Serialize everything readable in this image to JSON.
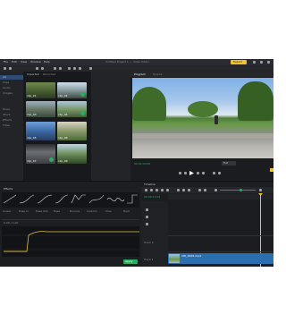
{
  "app": {
    "window_title": "Untitled Project 1 — Video Editor",
    "menu": [
      "File",
      "Edit",
      "View",
      "Window",
      "Help"
    ],
    "badge_label": "Export",
    "colors": {
      "bg": "#1f2024",
      "panel": "#232428",
      "accent_yellow": "#f2c12e",
      "accent_green": "#27ae60",
      "accent_blue": "#2a6fb0"
    }
  },
  "media_panel": {
    "tabs": [
      "Imported",
      "Recorded"
    ],
    "folders": [
      "All",
      "Clips",
      "Audio",
      "Images",
      "Music",
      "Stock",
      "Effects",
      "Titles"
    ],
    "thumbnails": [
      {
        "label": "clip_01"
      },
      {
        "label": "clip_02"
      },
      {
        "label": "clip_03"
      },
      {
        "label": "clip_04"
      },
      {
        "label": "clip_05"
      },
      {
        "label": "clip_06"
      },
      {
        "label": "clip_07"
      },
      {
        "label": "clip_08"
      }
    ]
  },
  "preview": {
    "tabs": [
      "Program",
      "Source"
    ],
    "timecode": "00:00:00:00",
    "mode_label": "Full"
  },
  "effects_panel": {
    "title": "Effects",
    "presets": [
      "Linear",
      "Ease In",
      "Ease Out",
      "Ease",
      "Bounce",
      "Custom",
      "Sine",
      "Back"
    ],
    "value_label": "0.00 / 1.00",
    "apply_label": "Apply"
  },
  "timeline": {
    "title": "Timeline",
    "timecode": "00:00:13:04",
    "tracks": [
      "Track 2",
      "Track 1"
    ],
    "clip_label": "VID_0001.mp4"
  }
}
